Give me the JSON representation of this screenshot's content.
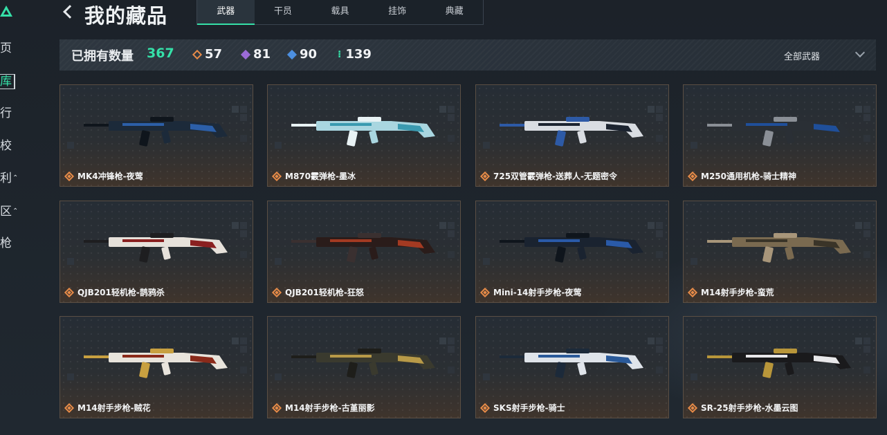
{
  "sidebar": {
    "items": [
      {
        "label": "页",
        "active": false
      },
      {
        "label": "库",
        "active": true
      },
      {
        "label": "行",
        "active": false
      },
      {
        "label": "校",
        "active": false
      },
      {
        "label": "利",
        "active": false,
        "caret": "⌃"
      },
      {
        "label": "区",
        "active": false,
        "caret": "⌃"
      },
      {
        "label": "枪",
        "active": false
      }
    ]
  },
  "header": {
    "title": "我的藏品",
    "tabs": [
      "武器",
      "干员",
      "载具",
      "挂饰",
      "典藏"
    ],
    "active_tab": 0
  },
  "summary": {
    "owned_label": "已拥有数量",
    "owned_count": "367",
    "stats": [
      {
        "value": "57",
        "color": "#e68b48"
      },
      {
        "value": "81",
        "color": "#9b6bd8"
      },
      {
        "value": "90",
        "color": "#4c8fe0"
      },
      {
        "value": "139",
        "color": "#35e0a8"
      }
    ],
    "filter_label": "全部武器"
  },
  "items": [
    {
      "name": "MK4冲锋枪-夜莺",
      "palette": [
        "#1c2a3a",
        "#2c5fa8",
        "#0f151c"
      ]
    },
    {
      "name": "M870霰弹枪-墨冰",
      "palette": [
        "#a9d6e0",
        "#3a9ab0",
        "#e8f2f4"
      ]
    },
    {
      "name": "725双管霰弹枪-送葬人-无题密令",
      "palette": [
        "#d9dde2",
        "#1c2430",
        "#2d5aa6"
      ]
    },
    {
      "name": "M250通用机枪-骑士精神",
      "palette": [
        "#2a2f35",
        "#1f4f9a",
        "#8a8f96"
      ]
    },
    {
      "name": "QJB201轻机枪-鹊鸦杀",
      "palette": [
        "#e6e1da",
        "#8a2020",
        "#1e1e20"
      ]
    },
    {
      "name": "QJB201轻机枪-狂怒",
      "palette": [
        "#2a1c1a",
        "#a33a22",
        "#3a3030"
      ]
    },
    {
      "name": "Mini-14射手步枪-夜莺",
      "palette": [
        "#1a2330",
        "#2a5aa8",
        "#0f151c"
      ]
    },
    {
      "name": "M14射手步枪-蛮荒",
      "palette": [
        "#7a6a50",
        "#3a3428",
        "#a8967a"
      ]
    },
    {
      "name": "M14射手步枪-贼花",
      "palette": [
        "#e8e4dc",
        "#8a2a1a",
        "#c8a040"
      ]
    },
    {
      "name": "M14射手步枪-古堇丽影",
      "palette": [
        "#3a3a2e",
        "#b89a48",
        "#1e1e1a"
      ]
    },
    {
      "name": "SKS射手步枪-骑士",
      "palette": [
        "#dfe4ea",
        "#2a5a9a",
        "#1c2a3a"
      ]
    },
    {
      "name": "SR-25射手步枪-水墨云图",
      "palette": [
        "#1a1a1c",
        "#e8e8ea",
        "#b8963a"
      ]
    }
  ]
}
